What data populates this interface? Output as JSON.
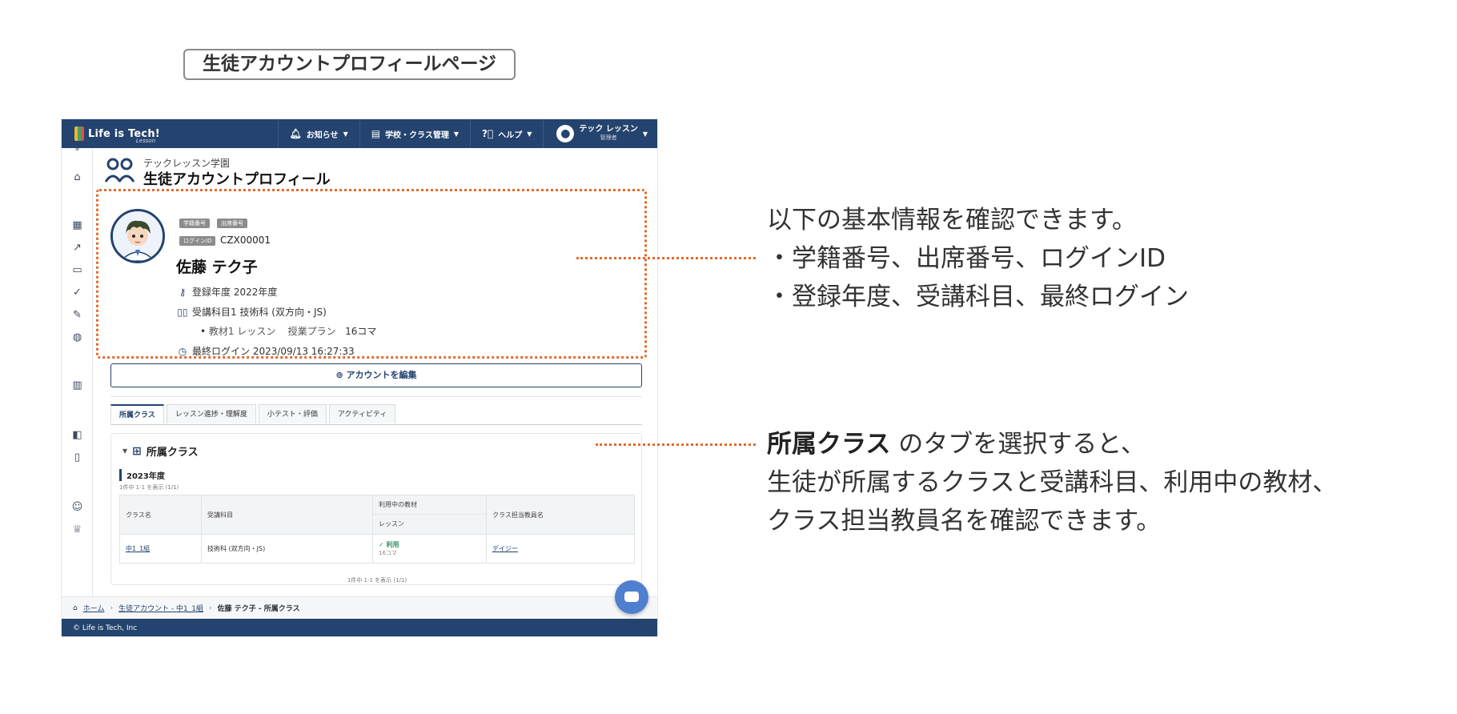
{
  "page_label": "生徒アカウントプロフィールページ",
  "topbar": {
    "logo_text": "Life is Tech!",
    "logo_sub": "Lesson",
    "nav": [
      {
        "label": "お知らせ",
        "icon": "bell-icon"
      },
      {
        "label": "学校・クラス管理",
        "icon": "building-icon"
      },
      {
        "label": "ヘルプ",
        "icon": "help-icon"
      }
    ],
    "user_name": "テック レッスン",
    "user_role": "管理者"
  },
  "sidebar_icons": [
    "collapse-icon",
    "home-icon",
    "calendar-icon",
    "trend-icon",
    "presentation-icon",
    "check-circle-icon",
    "pencil-icon",
    "palette-icon",
    "bar-chart-icon",
    "book-icon",
    "file-edit-icon",
    "smile-icon",
    "trophy-icon"
  ],
  "header": {
    "school": "テックレッスン学園",
    "title": "生徒アカウントプロフィール"
  },
  "profile": {
    "tag_student_no": "学籍番号",
    "tag_attendance_no": "出席番号",
    "tag_login_id": "ログインID",
    "login_id": "CZX00001",
    "name": "佐藤 テク子",
    "enrollment_year": "登録年度 2022年度",
    "subject": "受講科目1 技術科 (双方向・JS)",
    "material_label": "教材1 レッスン",
    "plan": "授業プラン",
    "plan_count": "16コマ",
    "last_login": "最終ログイン 2023/09/13 16:27:33"
  },
  "edit_button": "アカウントを編集",
  "tabs": [
    "所属クラス",
    "レッスン進捗・理解度",
    "小テスト・評価",
    "アクティビティ"
  ],
  "class_section": {
    "heading": "所属クラス",
    "year": "2023年度",
    "count_top": "1件中 1-1 を表示 (1/1)",
    "count_bottom": "1件中 1-1 を表示 (1/1)",
    "columns": {
      "class_name": "クラス名",
      "subject": "受講科目",
      "material": "利用中の教材",
      "material_sub": "レッスン",
      "teacher": "クラス担当教員名"
    },
    "row": {
      "class_name": "中1_1組",
      "subject": "技術科 (双方向・JS)",
      "status": "利用",
      "units": "16コマ",
      "teacher": "デイジー"
    }
  },
  "breadcrumb": {
    "home": "ホーム",
    "parent": "生徒アカウント - 中1_1組",
    "current": "佐藤 テク子 - 所属クラス"
  },
  "footer": "© Life is Tech, Inc",
  "notes": {
    "basic_line1": "以下の基本情報を確認できます。",
    "basic_line2": "・学籍番号、出席番号、ログインID",
    "basic_line3": "・登録年度、受講科目、最終ログイン",
    "class_bold": "所属クラス",
    "class_line1_rest": " のタブを選択すると、",
    "class_line2": "生徒が所属するクラスと受講科目、利用中の教材、",
    "class_line3": "クラス担当教員名を確認できます。"
  },
  "colors": {
    "primary": "#24436e",
    "highlight": "#e36b2c",
    "chat": "#4f7fcf"
  }
}
